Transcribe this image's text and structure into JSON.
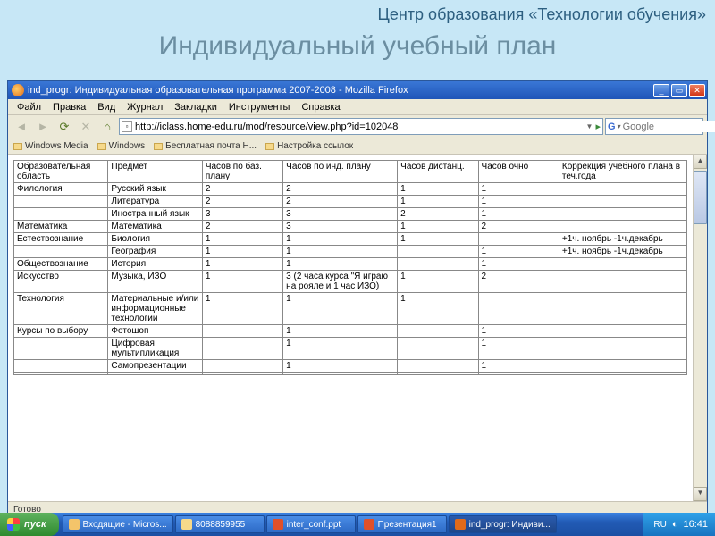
{
  "slide": {
    "org": "Центр образования «Технологии обучения»",
    "title": "Индивидуальный учебный план"
  },
  "window": {
    "title": "ind_progr: Индивидуальная образовательная программа 2007-2008 - Mozilla Firefox",
    "minimize": "_",
    "maximize": "▭",
    "close": "✕"
  },
  "menu": {
    "file": "Файл",
    "edit": "Правка",
    "view": "Вид",
    "history": "Журнал",
    "bookmarks": "Закладки",
    "tools": "Инструменты",
    "help": "Справка"
  },
  "toolbar": {
    "back": "◄",
    "forward": "►",
    "reload": "⟳",
    "stop": "✕",
    "home": "⌂",
    "url": "http://iclass.home-edu.ru/mod/resource/view.php?id=102048",
    "go": "▸",
    "search_engine": "G",
    "search_placeholder": "Google"
  },
  "bookmarks": {
    "b1": "Windows Media",
    "b2": "Windows",
    "b3": "Бесплатная почта H...",
    "b4": "Настройка ссылок"
  },
  "table": {
    "headers": {
      "area": "Образовательная область",
      "subject": "Предмет",
      "base": "Часов по баз. плану",
      "ind": "Часов по инд. плану",
      "dist": "Часов дистанц.",
      "face": "Часов очно",
      "corr": "Коррекция учебного плана в теч.года"
    },
    "rows": [
      {
        "area": "Филология",
        "subject": "Русский язык",
        "base": "2",
        "ind": "2",
        "dist": "1",
        "face": "1",
        "corr": ""
      },
      {
        "area": "",
        "subject": "Литература",
        "base": "2",
        "ind": "2",
        "dist": "1",
        "face": "1",
        "corr": ""
      },
      {
        "area": "",
        "subject": "Иностранный язык",
        "base": "3",
        "ind": "3",
        "dist": "2",
        "face": "1",
        "corr": ""
      },
      {
        "area": "Математика",
        "subject": "Математика",
        "base": "2",
        "ind": "3",
        "dist": "1",
        "face": "2",
        "corr": ""
      },
      {
        "area": "Естествознание",
        "subject": "Биология",
        "base": "1",
        "ind": "1",
        "dist": "1",
        "face": "",
        "corr": "+1ч. ноябрь -1ч.декабрь"
      },
      {
        "area": "",
        "subject": "География",
        "base": "1",
        "ind": "1",
        "dist": "",
        "face": "1",
        "corr": "+1ч. ноябрь -1ч.декабрь"
      },
      {
        "area": "Обществознание",
        "subject": "История",
        "base": "1",
        "ind": "1",
        "dist": "",
        "face": "1",
        "corr": ""
      },
      {
        "area": "Искусство",
        "subject": "Музыка, ИЗО",
        "base": "1",
        "ind": "3 (2 часа курса \"Я играю на рояле и 1 час ИЗО)",
        "dist": "1",
        "face": "2",
        "corr": ""
      },
      {
        "area": "Технология",
        "subject": "Материальные и/или информационные технологии",
        "base": "1",
        "ind": "1",
        "dist": "1",
        "face": "",
        "corr": ""
      },
      {
        "area": "Курсы по выбору",
        "subject": "Фотошоп",
        "base": "",
        "ind": "1",
        "dist": "",
        "face": "1",
        "corr": ""
      },
      {
        "area": "",
        "subject": "Цифровая мультипликация",
        "base": "",
        "ind": "1",
        "dist": "",
        "face": "1",
        "corr": ""
      },
      {
        "area": "",
        "subject": "Самопрезентации",
        "base": "",
        "ind": "1",
        "dist": "",
        "face": "1",
        "corr": ""
      },
      {
        "area": "",
        "subject": "",
        "base": "",
        "ind": "",
        "dist": "",
        "face": "",
        "corr": ""
      }
    ]
  },
  "status": {
    "text": "Готово"
  },
  "taskbar": {
    "start": "пуск",
    "items": [
      {
        "label": "Входящие - Micros...",
        "color": "#f4c46a"
      },
      {
        "label": "8088859955",
        "color": "#f6d98a"
      },
      {
        "label": "inter_conf.ppt",
        "color": "#e0502a"
      },
      {
        "label": "Презентация1",
        "color": "#e0502a"
      },
      {
        "label": "ind_progr: Индиви...",
        "color": "#e06a1a",
        "active": true
      }
    ],
    "lang": "RU",
    "clock": "16:41"
  }
}
